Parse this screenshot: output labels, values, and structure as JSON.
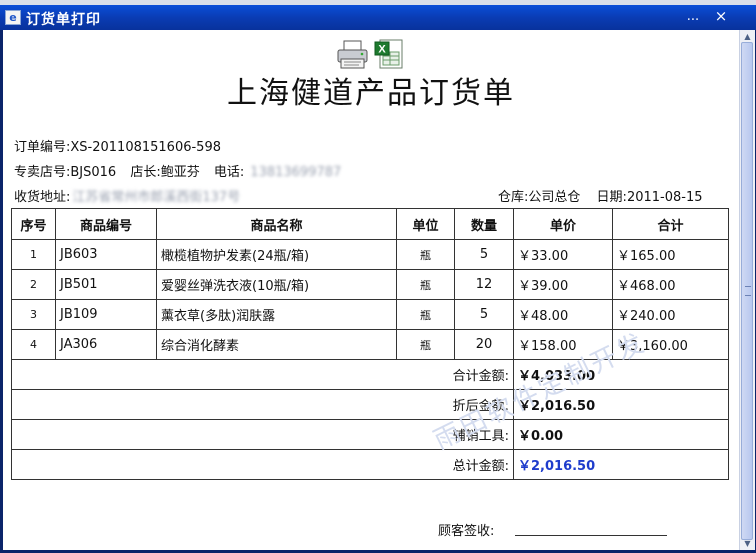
{
  "window": {
    "title": "订货单打印",
    "icon": "app-icon",
    "controls": [
      "...",
      "×"
    ]
  },
  "toolbar": {
    "print_icon": "printer-icon",
    "export_icon": "excel-icon"
  },
  "document": {
    "title": "上海健道产品订货单",
    "order_no_label": "订单编号:",
    "order_no": "XS-201108151606-598",
    "store_no_label": "专卖店号:",
    "store_no": "BJS016",
    "manager_label": "店长:",
    "manager": "鲍亚芬",
    "phone_label": "电话:",
    "phone": "13813699787",
    "address_label": "收货地址:",
    "address": "江苏省常州市郎溪西街137号",
    "warehouse_label": "仓库:",
    "warehouse": "公司总仓",
    "date_label": "日期:",
    "date": "2011-08-15"
  },
  "table": {
    "headers": [
      "序号",
      "商品编号",
      "商品名称",
      "单位",
      "数量",
      "单价",
      "合计"
    ],
    "rows": [
      {
        "no": "1",
        "code": "JB603",
        "name": "橄榄植物护发素(24瓶/箱)",
        "unit": "瓶",
        "qty": "5",
        "price": "￥33.00",
        "total": "￥165.00"
      },
      {
        "no": "2",
        "code": "JB501",
        "name": "爱婴丝弹洗衣液(10瓶/箱)",
        "unit": "瓶",
        "qty": "12",
        "price": "￥39.00",
        "total": "￥468.00"
      },
      {
        "no": "3",
        "code": "JB109",
        "name": "薰衣草(多肽)润肤露",
        "unit": "瓶",
        "qty": "5",
        "price": "￥48.00",
        "total": "￥240.00"
      },
      {
        "no": "4",
        "code": "JA306",
        "name": "综合消化酵素",
        "unit": "瓶",
        "qty": "20",
        "price": "￥158.00",
        "total": "￥3,160.00"
      }
    ],
    "summary": [
      {
        "label": "合计金额:",
        "value": "￥4,033.00"
      },
      {
        "label": "折后金额:",
        "value": "￥2,016.50"
      },
      {
        "label": "辅销工具:",
        "value": "￥0.00"
      },
      {
        "label": "总计金额:",
        "value": "￥2,016.50"
      }
    ]
  },
  "signature": {
    "label": "顾客签收:"
  },
  "watermark": "雨田软件定制开发",
  "colors": {
    "titlebar": "#0a3cb4",
    "grand_total": "#1e3ccc"
  }
}
